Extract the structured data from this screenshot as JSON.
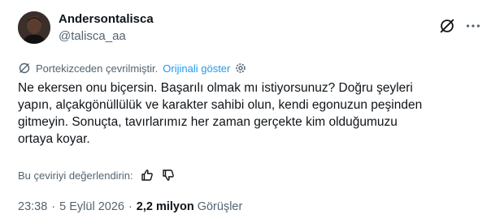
{
  "user": {
    "display_name": "Andersontalisca",
    "handle": "@talisca_aa"
  },
  "icons": {
    "avatar": "profile-photo",
    "grok": "grok-icon",
    "more": "more-horizontal-icon",
    "translate": "translate-icon",
    "settings": "gear-icon",
    "thumbs_up": "thumbs-up-icon",
    "thumbs_down": "thumbs-down-icon"
  },
  "translation": {
    "notice": "Portekizceden çevrilmiştir.",
    "show_original": "Orijinali göster"
  },
  "tweet": {
    "text": "Ne ekersen onu biçersin. Başarılı olmak mı istiyorsunuz? Doğru şeyleri\nyapın, alçakgönüllülük ve karakter sahibi olun, kendi egonuzun peşinden\ngitmeyin. Sonuçta, tavırlarımız her zaman gerçekte kim olduğumuzu\nortaya koyar."
  },
  "rating": {
    "prompt": "Bu çeviriyi değerlendirin:"
  },
  "meta": {
    "time": "23:38",
    "separator": "·",
    "date": "5 Eylül 2026",
    "views_count": "2,2 milyon",
    "views_label": "Görüşler"
  },
  "colors": {
    "text_primary": "#0f1419",
    "text_secondary": "#536471",
    "link": "#1d9bf0"
  }
}
